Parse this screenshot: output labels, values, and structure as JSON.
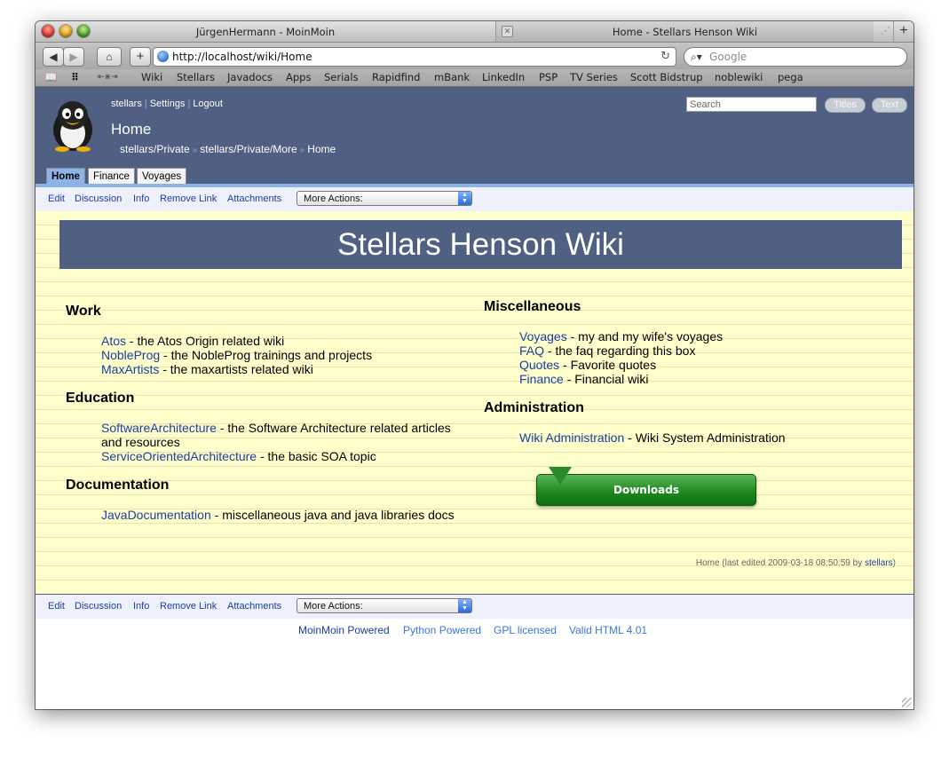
{
  "browser": {
    "tabs": [
      "JürgenHermann - MoinMoin",
      "Home - Stellars Henson Wiki"
    ],
    "url": "http://localhost/wiki/Home",
    "search_placeholder": "Google",
    "bookmarks": [
      "Wiki",
      "Stellars",
      "Javadocs",
      "Apps",
      "Serials",
      "Rapidfind",
      "mBank",
      "LinkedIn",
      "PSP",
      "TV Series",
      "Scott Bidstrup",
      "noblewiki",
      "pega"
    ]
  },
  "header": {
    "user_links": [
      "stellars",
      "Settings",
      "Logout"
    ],
    "page_title": "Home",
    "breadcrumbs": [
      "stellars/Private",
      "stellars/Private/More",
      "Home"
    ],
    "search_placeholder": "Search",
    "titles_button": "Titles",
    "text_button": "Text",
    "nav_tabs": [
      "Home",
      "Finance",
      "Voyages"
    ]
  },
  "editbar": {
    "links": [
      "Edit",
      "Discussion",
      "Info",
      "Remove Link",
      "Attachments"
    ],
    "more_actions": "More Actions:"
  },
  "content": {
    "banner": "Stellars Henson Wiki",
    "left": [
      {
        "heading": "Work",
        "items": [
          {
            "link": "Atos",
            "desc": " - the Atos Origin related wiki"
          },
          {
            "link": "NobleProg",
            "desc": " - the NobleProg trainings and projects"
          },
          {
            "link": "MaxArtists",
            "desc": " - the maxartists related wiki"
          }
        ]
      },
      {
        "heading": "Education",
        "items": [
          {
            "link": "SoftwareArchitecture",
            "desc": " - the Software Architecture related articles and resources"
          },
          {
            "link": "ServiceOrientedArchitecture",
            "desc": " - the basic SOA topic"
          }
        ]
      },
      {
        "heading": "Documentation",
        "items": [
          {
            "link": "JavaDocumentation",
            "desc": " - miscellaneous java and java libraries docs"
          }
        ]
      }
    ],
    "right": [
      {
        "heading": "Miscellaneous",
        "items": [
          {
            "link": "Voyages",
            "desc": " - my and my wife's voyages"
          },
          {
            "link": "FAQ",
            "desc": " - the faq regarding this box"
          },
          {
            "link": "Quotes",
            "desc": " - Favorite quotes"
          },
          {
            "link": "Finance",
            "desc": " - Financial wiki"
          }
        ]
      },
      {
        "heading": "Administration",
        "items": [
          {
            "link": "Wiki Administration",
            "desc": " - Wiki System Administration"
          }
        ]
      }
    ],
    "downloads_button": "Downloads",
    "page_info_prefix": "Home (last edited 2009-03-18 08:50:59 by ",
    "page_info_user": "stellars",
    "page_info_suffix": ")"
  },
  "footer": {
    "links": [
      "MoinMoin Powered",
      "Python Powered",
      "GPL licensed",
      "Valid HTML 4.01"
    ],
    "colors": [
      "#1a3fa0",
      "#3a77d8",
      "#3a77d8",
      "#3a77d8"
    ]
  }
}
